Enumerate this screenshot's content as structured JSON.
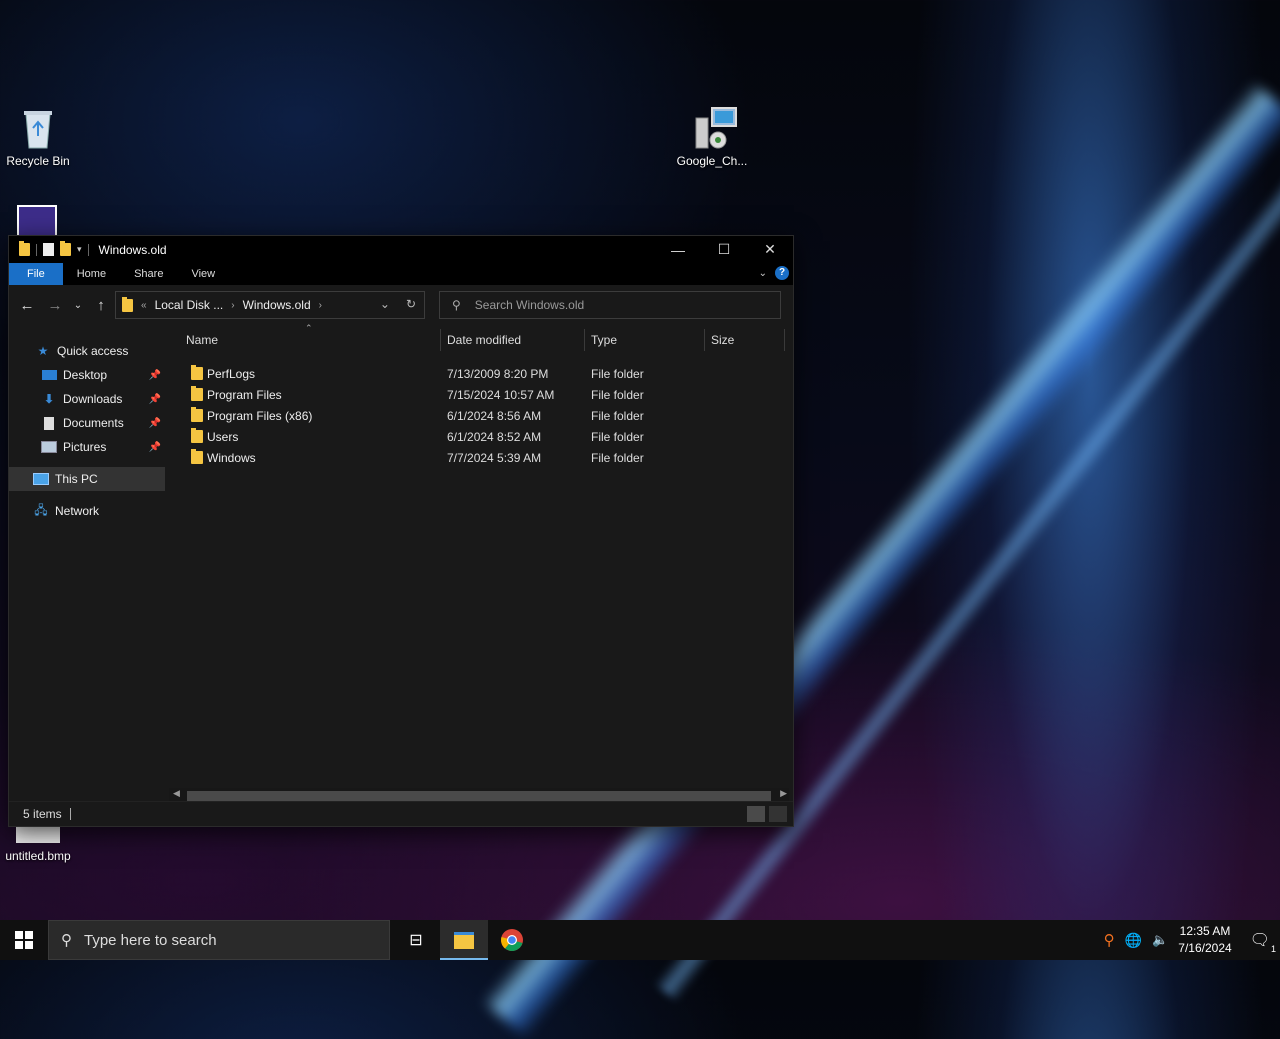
{
  "desktop": {
    "icons": [
      {
        "label": "Recycle Bin",
        "icon": "recycle-bin-icon"
      },
      {
        "label": "Google_Ch...",
        "icon": "installer-icon"
      },
      {
        "label": "untitled.bmp",
        "icon": "bitmap-file-icon"
      }
    ]
  },
  "window": {
    "title": "Windows.old",
    "ribbon_tabs": [
      "File",
      "Home",
      "Share",
      "View"
    ],
    "breadcrumb": [
      "Local Disk ...",
      "Windows.old"
    ],
    "search_placeholder": "Search Windows.old",
    "sidebar": [
      {
        "label": "Quick access",
        "icon": "star-icon"
      },
      {
        "label": "Desktop",
        "icon": "desktop-icon",
        "pinned": true
      },
      {
        "label": "Downloads",
        "icon": "download-icon",
        "pinned": true
      },
      {
        "label": "Documents",
        "icon": "documents-icon",
        "pinned": true
      },
      {
        "label": "Pictures",
        "icon": "pictures-icon",
        "pinned": true
      },
      {
        "label": "This PC",
        "icon": "computer-icon",
        "selected": true
      },
      {
        "label": "Network",
        "icon": "network-icon"
      }
    ],
    "columns": [
      "Name",
      "Date modified",
      "Type",
      "Size"
    ],
    "files": [
      {
        "name": "PerfLogs",
        "date": "7/13/2009 8:20 PM",
        "type": "File folder",
        "size": ""
      },
      {
        "name": "Program Files",
        "date": "7/15/2024 10:57 AM",
        "type": "File folder",
        "size": ""
      },
      {
        "name": "Program Files (x86)",
        "date": "6/1/2024 8:56 AM",
        "type": "File folder",
        "size": ""
      },
      {
        "name": "Users",
        "date": "6/1/2024 8:52 AM",
        "type": "File folder",
        "size": ""
      },
      {
        "name": "Windows",
        "date": "7/7/2024 5:39 AM",
        "type": "File folder",
        "size": ""
      }
    ],
    "status": "5 items"
  },
  "taskbar": {
    "search_placeholder": "Type here to search",
    "time": "12:35 AM",
    "date": "7/16/2024",
    "notification_count": "1"
  },
  "colors": {
    "accent": "#1a6fc7",
    "folder": "#f5c542"
  }
}
